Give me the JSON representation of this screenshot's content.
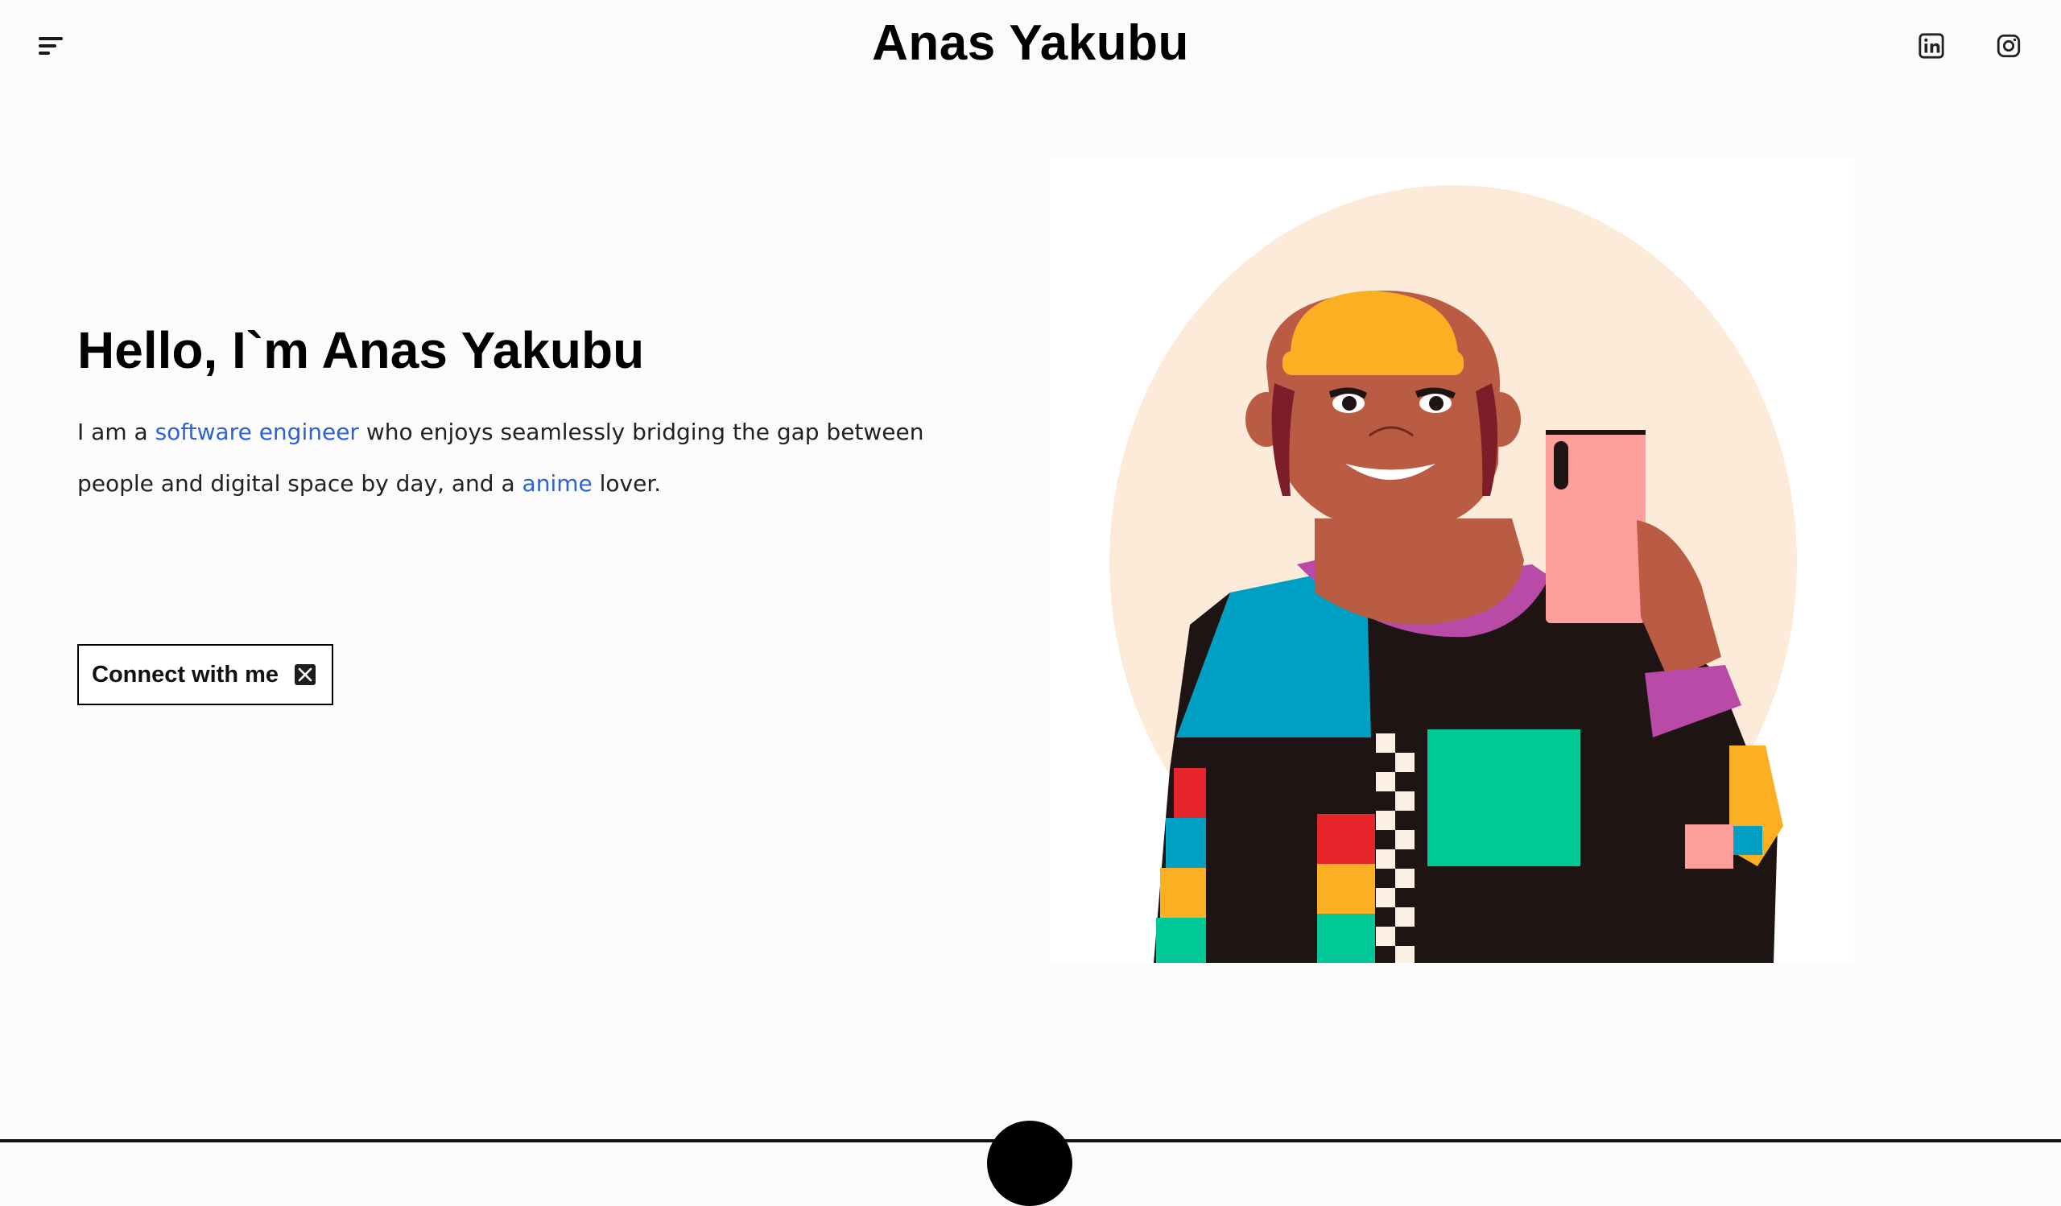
{
  "header": {
    "title": "Anas Yakubu",
    "menu_icon": "menu-icon",
    "social": [
      {
        "name": "LinkedIn",
        "icon": "linkedin-icon"
      },
      {
        "name": "Instagram",
        "icon": "instagram-icon"
      }
    ]
  },
  "hero": {
    "heading": "Hello, I`m Anas Yakubu",
    "intro_before": "I am a ",
    "role_link": "software engineer",
    "intro_middle": " who enjoys seamlessly bridging the gap between people and digital space by day, and a ",
    "hobby_link": "anime",
    "intro_after": " lover.",
    "cta_label": "Connect with me",
    "cta_icon": "x-icon"
  },
  "colors": {
    "accent_link": "#2f62d1",
    "background": "#fbfbfb",
    "circle": "#fdebd9",
    "hat": "#fbb023",
    "skin": "#b95c43",
    "phone": "#ff9f9c"
  }
}
